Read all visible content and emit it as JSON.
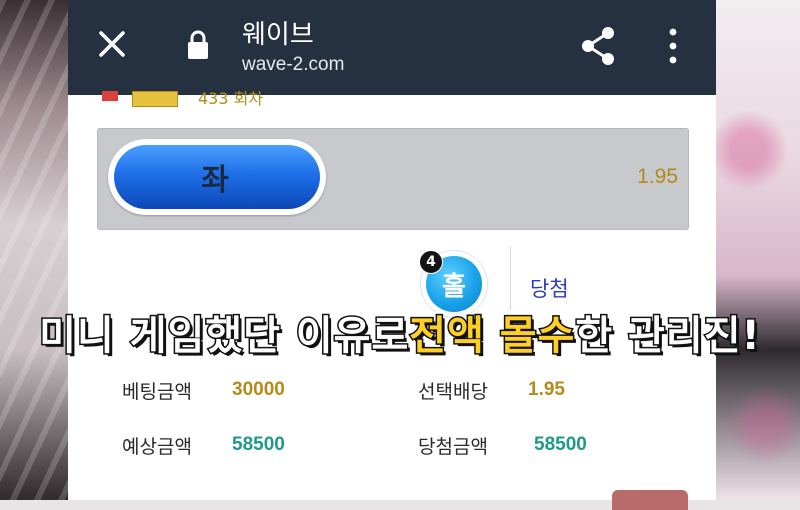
{
  "browser": {
    "title": "웨이브",
    "url": "wave-2.com"
  },
  "previous_round": {
    "text": "433 회차"
  },
  "bet": {
    "side_label": "좌",
    "odds": "1.95"
  },
  "result": {
    "ball_label": "홀",
    "count": "4",
    "status": "당첨"
  },
  "banner": {
    "part1": "미니 게임했단 이유로 ",
    "part2": "전액 몰수",
    "part3": "한 관리진!"
  },
  "details": {
    "bet_amount_label": "베팅금액",
    "bet_amount_value": "30000",
    "selected_odds_label": "선택배당",
    "selected_odds_value": "1.95",
    "expected_amount_label": "예상금액",
    "expected_amount_value": "58500",
    "win_amount_label": "당첨금액",
    "win_amount_value": "58500"
  },
  "colors": {
    "toolbar": "#253140",
    "odds_gold": "#b48a18",
    "value_teal": "#1c9a8a",
    "win_blue": "#2a3eb6",
    "banner_yellow": "#ffcf24"
  },
  "icons": [
    "close-icon",
    "lock-icon",
    "share-icon",
    "more-vert-icon"
  ]
}
